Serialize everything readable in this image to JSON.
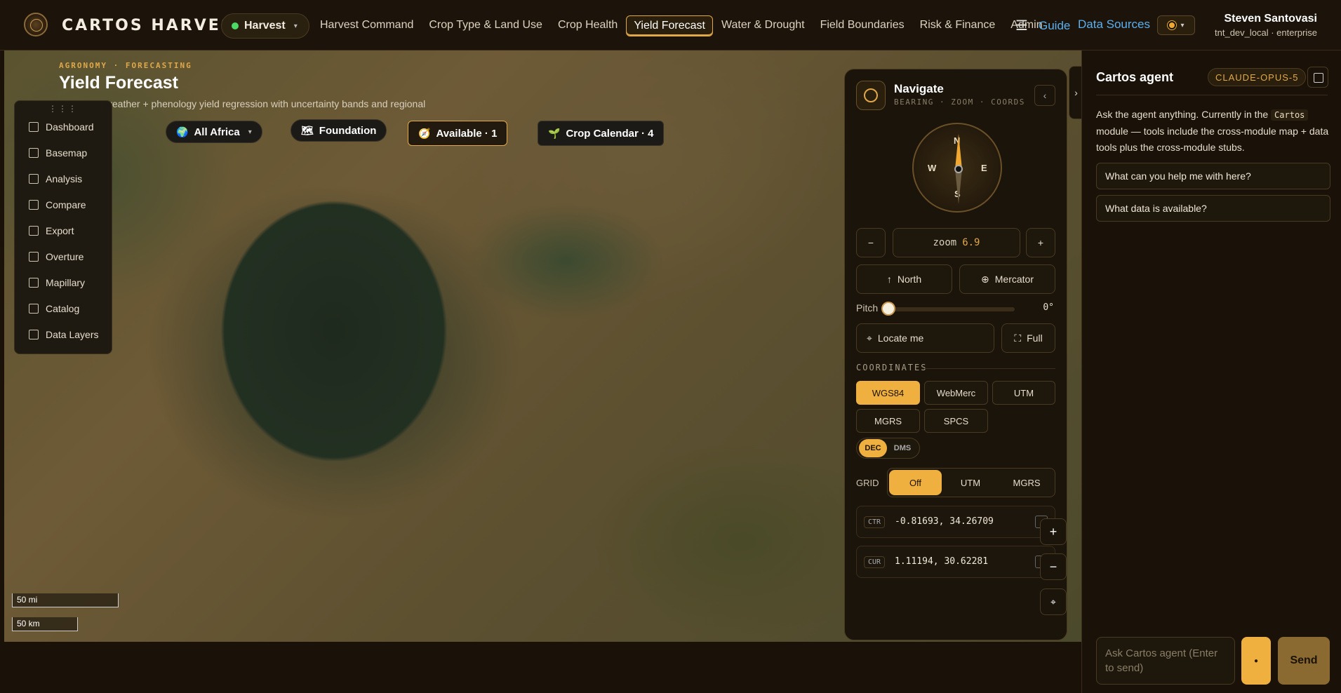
{
  "header": {
    "brand": "CARTOS HARVEST",
    "module": "Harvest",
    "nav": [
      "Harvest Command",
      "Crop Type & Land Use",
      "Crop Health",
      "Yield Forecast",
      "Water & Drought",
      "Field Boundaries",
      "Risk & Finance",
      "Admin"
    ],
    "active_nav": "Yield Forecast",
    "guide": "Guide",
    "data_sources": "Data Sources",
    "user_name": "Steven Santovasi",
    "user_sub": "tnt_dev_local · enterprise"
  },
  "page": {
    "breadcrumb": "AGRONOMY · FORECASTING",
    "title": "Yield Forecast",
    "description": "Satellite + weather + phenology yield regression with uncertainty bands and regional reporting."
  },
  "toolbar": {
    "items": [
      "Dashboard",
      "Basemap",
      "Analysis",
      "Compare",
      "Export",
      "Overture",
      "Mapillary",
      "Catalog",
      "Data Layers"
    ]
  },
  "chips": {
    "region": "All Africa",
    "foundation": "Foundation",
    "available": "Available · 1",
    "crop_calendar": "Crop Calendar · 4"
  },
  "scale": {
    "mi": "50 mi",
    "km": "50 km"
  },
  "navigate": {
    "title": "Navigate",
    "subtitle": "BEARING · ZOOM · COORDS",
    "compass": {
      "n": "N",
      "s": "S",
      "e": "E",
      "w": "W"
    },
    "zoom_label": "zoom",
    "zoom_value": "6.9",
    "north": "North",
    "projection": "Mercator",
    "pitch_label": "Pitch",
    "pitch_value": "0°",
    "locate": "Locate me",
    "full": "Full",
    "coords_section": "COORDINATES",
    "coord_systems": [
      "WGS84",
      "WebMerc",
      "UTM",
      "MGRS",
      "SPCS"
    ],
    "active_coord_system": "WGS84",
    "format_dec": "DEC",
    "format_dms": "DMS",
    "grid_label": "GRID",
    "grid_options": [
      "Off",
      "UTM",
      "MGRS"
    ],
    "active_grid": "Off",
    "ctr_tag": "CTR",
    "ctr_value": "-0.81693, 34.26709",
    "cur_tag": "CUR",
    "cur_value": "1.11194, 30.62281"
  },
  "agent": {
    "title": "Cartos agent",
    "model": "CLAUDE-OPUS-5",
    "intro_a": "Ask the agent anything. Currently in the",
    "intro_code": "Cartos",
    "intro_b": "module — tools include the cross-module map + data tools plus the cross-module stubs.",
    "suggestions": [
      "What can you help me with here?",
      "What data is available?"
    ],
    "input_placeholder": "Ask Cartos agent (Enter to send)",
    "send": "Send"
  }
}
